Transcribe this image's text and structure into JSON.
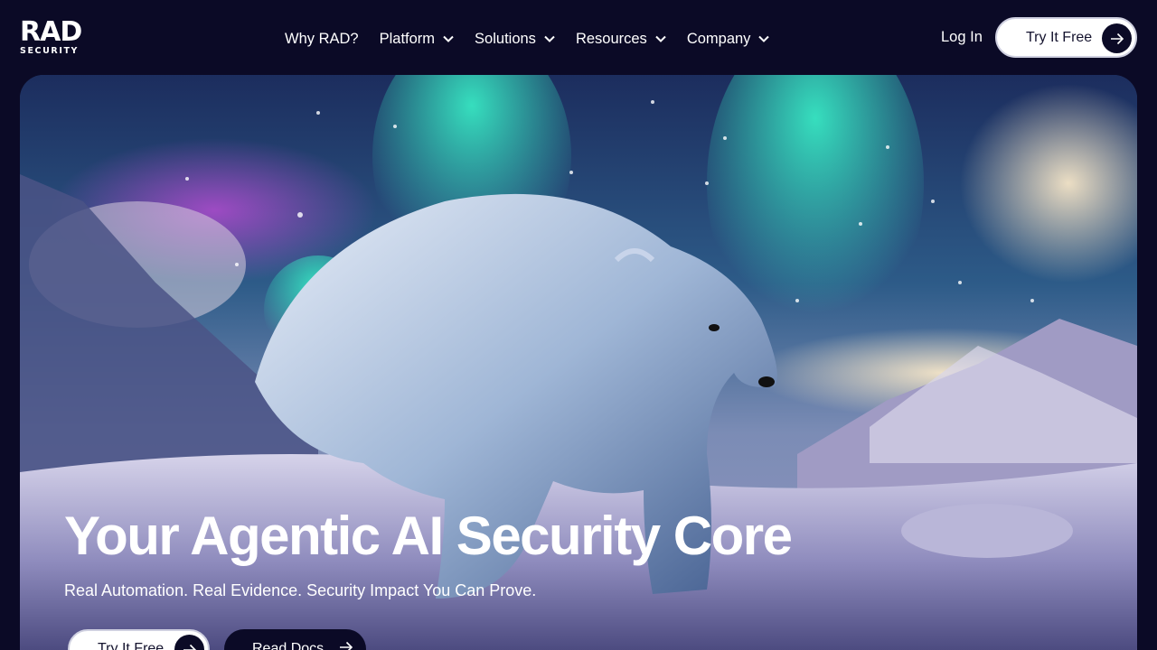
{
  "brand": {
    "name": "RAD",
    "sub": "SECURITY"
  },
  "nav": {
    "items": [
      {
        "label": "Why RAD?",
        "has_dropdown": false
      },
      {
        "label": "Platform",
        "has_dropdown": true
      },
      {
        "label": "Solutions",
        "has_dropdown": true
      },
      {
        "label": "Resources",
        "has_dropdown": true
      },
      {
        "label": "Company",
        "has_dropdown": true
      }
    ],
    "login_label": "Log In",
    "cta_label": "Try It Free"
  },
  "hero": {
    "title": "Your Agentic AI Security Core",
    "subtitle": "Real Automation. Real Evidence. Security Impact You Can Prove.",
    "primary_button": "Try It Free",
    "secondary_button": "Read Docs",
    "image_subject": "polar bear under aurora borealis"
  },
  "colors": {
    "background": "#0b0a26",
    "button_light": "#ffffff",
    "button_dark": "#0b0a26"
  }
}
